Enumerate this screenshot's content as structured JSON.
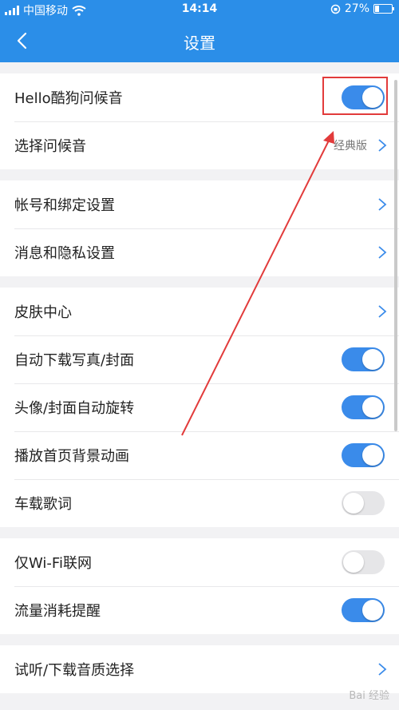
{
  "status_bar": {
    "carrier": "中国移动",
    "time": "14:14",
    "battery": "27%"
  },
  "nav": {
    "title": "设置"
  },
  "groups": [
    {
      "rows": [
        {
          "label": "Hello酷狗问候音",
          "toggle": true
        },
        {
          "label": "选择问候音",
          "value": "经典版"
        }
      ]
    },
    {
      "rows": [
        {
          "label": "帐号和绑定设置"
        },
        {
          "label": "消息和隐私设置"
        }
      ]
    },
    {
      "rows": [
        {
          "label": "皮肤中心"
        },
        {
          "label": "自动下载写真/封面",
          "toggle": true
        },
        {
          "label": "头像/封面自动旋转",
          "toggle": true
        },
        {
          "label": "播放首页背景动画",
          "toggle": true
        },
        {
          "label": "车载歌词",
          "toggle": false
        }
      ]
    },
    {
      "rows": [
        {
          "label": "仅Wi-Fi联网",
          "toggle": false
        },
        {
          "label": "流量消耗提醒",
          "toggle": true
        }
      ]
    },
    {
      "rows": [
        {
          "label": "试听/下载音质选择"
        }
      ]
    }
  ],
  "watermark": "Bai 经验",
  "colors": {
    "header": "#2b8ee8",
    "toggle_on": "#3a8bea",
    "annotation": "#e23b3b"
  }
}
